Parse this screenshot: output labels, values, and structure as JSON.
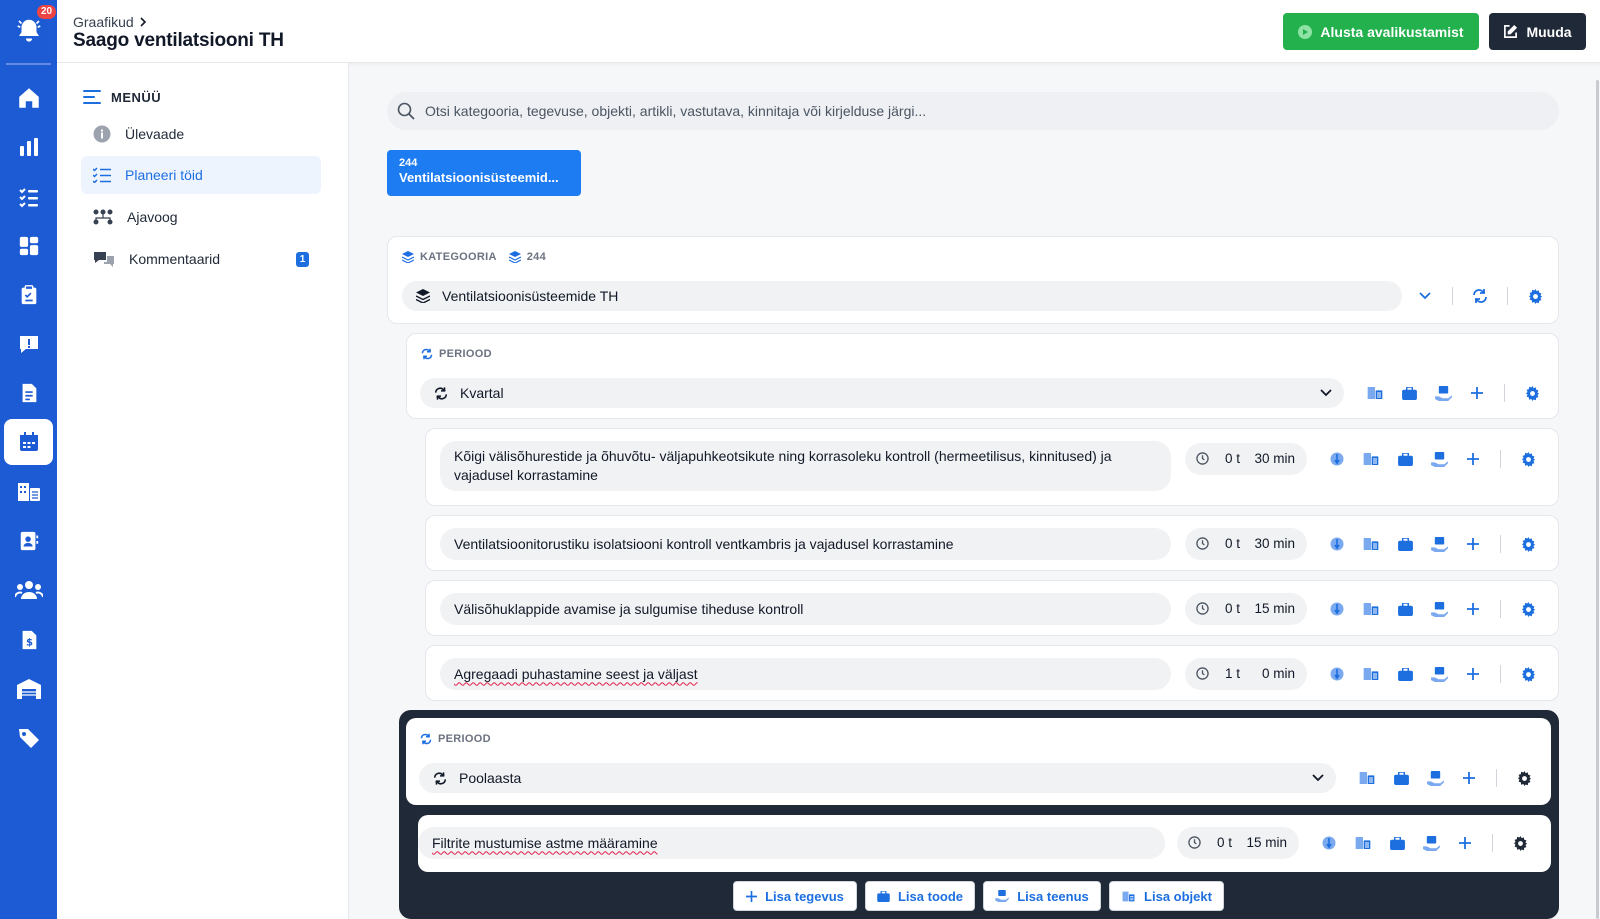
{
  "rail": {
    "notification_count": "20",
    "items": [
      "home-icon",
      "bar-chart-icon",
      "checklist-icon",
      "dashboard-icon",
      "clipboard-icon",
      "alert-icon",
      "document-icon",
      "calendar-icon",
      "building-list-icon",
      "contact-card-icon",
      "users-icon",
      "invoice-icon",
      "warehouse-icon",
      "tag-icon"
    ],
    "active": "calendar-icon"
  },
  "header": {
    "breadcrumb": "Graafikud",
    "title": "Saago ventilatsiooni TH",
    "start_button": "Alusta avalikustamist",
    "edit_button": "Muuda"
  },
  "menu": {
    "title": "MENÜÜ",
    "items": [
      {
        "label": "Ülevaade",
        "icon": "info-icon"
      },
      {
        "label": "Planeeri töid",
        "icon": "checklist-icon",
        "active": true
      },
      {
        "label": "Ajavoog",
        "icon": "timeline-icon"
      },
      {
        "label": "Kommentaarid",
        "icon": "comments-icon",
        "count": "1"
      }
    ]
  },
  "search": {
    "placeholder": "Otsi kategooria, tegevuse, objekti, artikli, vastutava, kinnitaja või kirjelduse järgi..."
  },
  "category_chip": {
    "number": "244",
    "label": "Ventilatsioonisüsteemid..."
  },
  "category": {
    "section_label": "KATEGOORIA",
    "code": "244",
    "value": "Ventilatsioonisüsteemide TH"
  },
  "periods": [
    {
      "section_label": "PERIOOD",
      "value": "Kvartal",
      "tasks": [
        {
          "text": "Kõigi välisõhurestide ja õhuvõtu- väljapuhkeotsikute ning korrasoleku kontroll (hermeetilisus, kinnitused) ja vajadusel korrastamine",
          "hours": "0 t",
          "minutes": "30 min"
        },
        {
          "text": "Ventilatsioonitorustiku isolatsiooni kontroll ventkambris ja vajadusel korrastamine",
          "hours": "0 t",
          "minutes": "30 min"
        },
        {
          "text": "Välisõhuklappide avamise ja sulgumise tiheduse kontroll",
          "hours": "0 t",
          "minutes": "15 min"
        },
        {
          "text": "Agregaadi puhastamine seest ja väljast",
          "hours": "1 t",
          "minutes": "0 min"
        }
      ]
    },
    {
      "section_label": "PERIOOD",
      "value": "Poolaasta",
      "tasks": [
        {
          "text": "Filtrite mustumise astme määramine",
          "hours": "0 t",
          "minutes": "15 min"
        }
      ]
    }
  ],
  "add_buttons": {
    "activity": "Lisa tegevus",
    "product": "Lisa toode",
    "service": "Lisa teenus",
    "object": "Lisa objekt"
  },
  "colors": {
    "rail": "#1d5bd4",
    "accent": "#1d6fe0",
    "start_green": "#22b14c",
    "dark": "#1f2937"
  }
}
